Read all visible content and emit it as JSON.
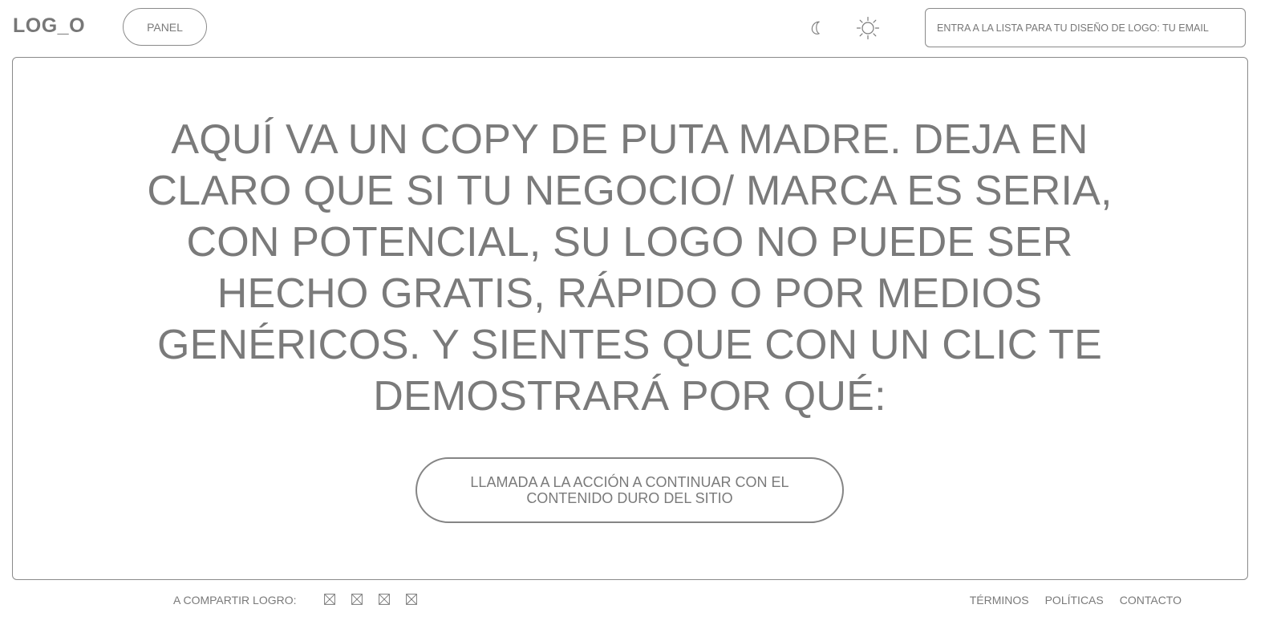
{
  "header": {
    "logo": "LOG_O",
    "panel_label": "PANEL",
    "theme_icons": [
      "moon-icon",
      "sun-icon"
    ],
    "email_placeholder": "ENTRA A LA LISTA PARA TU DISEÑO DE LOGO: TU EMAIL"
  },
  "hero": {
    "headline": "AQUÍ VA UN COPY DE PUTA MADRE. DEJA EN CLARO QUE SI TU NEGOCIO/ MARCA ES SERIA, CON POTENCIAL, SU LOGO NO PUEDE SER HECHO GRATIS, RÁPIDO O POR MEDIOS GENÉRICOS. Y SIENTES QUE CON UN CLIC TE DEMOSTRARÁ POR QUÉ:",
    "cta_label": "LLAMADA A LA ACCIÓN A CONTINUAR CON EL CONTENIDO DURO DEL SITIO"
  },
  "footer": {
    "share_label": "A COMPARTIR LOGRO:",
    "share_icons": [
      "image-placeholder-icon",
      "image-placeholder-icon",
      "image-placeholder-icon",
      "image-placeholder-icon"
    ],
    "links": [
      "TÉRMINOS",
      "POLÍTICAS",
      "CONTACTO"
    ]
  },
  "colors": {
    "text": "#7a7a7a",
    "border": "#8a8a8a",
    "background": "#ffffff"
  }
}
